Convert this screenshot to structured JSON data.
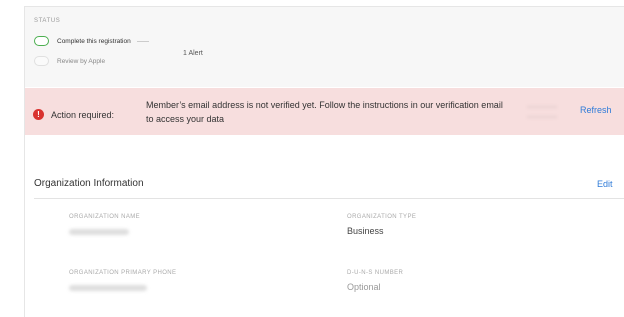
{
  "status": {
    "label": "STATUS",
    "steps": [
      {
        "label": "Complete this registration",
        "state": "active"
      },
      {
        "label": "Review by Apple",
        "state": "pending"
      }
    ],
    "alert_count": "1 Alert"
  },
  "alert": {
    "icon": "exclamation-icon",
    "title": "Action required:",
    "message": "Member’s email address is not verified yet. Follow the instructions in our verification email to access your data",
    "action_label": "Refresh",
    "color": "#d9322f",
    "background": "#f7dede"
  },
  "organization": {
    "header": "Organization Information",
    "edit_label": "Edit",
    "fields": {
      "name": {
        "label": "ORGANIZATION NAME",
        "value": ""
      },
      "type": {
        "label": "ORGANIZATION TYPE",
        "value": "Business"
      },
      "phone": {
        "label": "ORGANIZATION PRIMARY PHONE",
        "value": ""
      },
      "duns": {
        "label": "D-U-N-S NUMBER",
        "value": "Optional"
      }
    }
  },
  "colors": {
    "link": "#2f7bd8",
    "active_step": "#4caf50"
  }
}
